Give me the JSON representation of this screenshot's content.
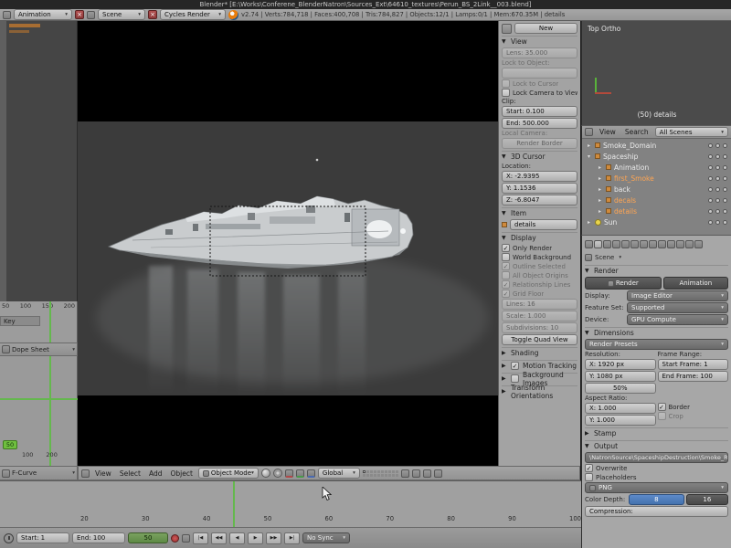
{
  "window": {
    "title": "Blender* [E:\\Works\\Conferene_BlenderNatron\\Sources_Ext\\64610_textures\\Perun_BS_2Link__003.blend]"
  },
  "infobar": {
    "layout_label": "Animation",
    "scene_label": "Scene",
    "engine_label": "Cycles Render",
    "stats": "v2.74 | Verts:784,718 | Faces:400,708 | Tris:784,827 | Objects:12/1 | Lamps:0/1 | Mem:670.35M | details"
  },
  "left": {
    "dope": {
      "ruler": [
        "50",
        "100",
        "150",
        "200"
      ],
      "channel": "Key",
      "header": "Dope Sheet"
    },
    "graph": {
      "frame": "50",
      "ruler": [
        "100",
        "200"
      ],
      "header": "F-Curve"
    }
  },
  "viewport": {
    "menus": [
      "View",
      "Select",
      "Add",
      "Object"
    ],
    "mode": "Object Mode",
    "orientation": "Global"
  },
  "npanel": {
    "new_button": "New",
    "view": {
      "title": "View",
      "lens": "Lens: 35.000",
      "lock_to_object": "Lock to Object:",
      "lock_to_cursor": "Lock to Cursor",
      "lock_camera": "Lock Camera to View",
      "clip": "Clip:",
      "clip_start": "Start: 0.100",
      "clip_end": "End: 500.000",
      "local_camera": "Local Camera:",
      "render_border": "Render Border"
    },
    "cursor3d": {
      "title": "3D Cursor",
      "location": "Location:",
      "x": "X: -2.9395",
      "y": "Y: 1.1536",
      "z": "Z: -6.8047"
    },
    "item": {
      "title": "Item",
      "name": "details"
    },
    "display": {
      "title": "Display",
      "items": [
        {
          "label": "Only Render",
          "checked": true
        },
        {
          "label": "World Background",
          "checked": false
        },
        {
          "label": "Outline Selected",
          "checked": true
        },
        {
          "label": "All Object Origins",
          "checked": false
        },
        {
          "label": "Relationship Lines",
          "checked": true
        },
        {
          "label": "Grid Floor",
          "checked": true
        }
      ],
      "lines": "Lines: 16",
      "scale": "Scale: 1.000",
      "subdivisions": "Subdivisions: 10",
      "toggle_quad": "Toggle Quad View"
    },
    "collapsed": [
      {
        "label": "Shading"
      },
      {
        "label": "Motion Tracking"
      },
      {
        "label": "Background Images"
      },
      {
        "label": "Transform Orientations"
      }
    ]
  },
  "miniview": {
    "label": "Top Ortho",
    "info": "(50) details"
  },
  "outliner": {
    "view": "View",
    "search": "Search",
    "scope": "All Scenes",
    "rows": [
      {
        "label": "Smoke_Domain"
      },
      {
        "label": "Spaceship"
      },
      {
        "label": "Animation"
      },
      {
        "label": "first_Smoke"
      },
      {
        "label": "back"
      },
      {
        "label": "decals"
      },
      {
        "label": "details"
      },
      {
        "label": "Sun"
      }
    ]
  },
  "properties": {
    "breadcrumb": "Scene",
    "render": {
      "title": "Render",
      "render_btn": "Render",
      "animation_btn": "Animation",
      "display_label": "Display:",
      "display_value": "Image Editor",
      "feature_label": "Feature Set:",
      "feature_value": "Supported",
      "device_label": "Device:",
      "device_value": "GPU Compute"
    },
    "dimensions": {
      "title": "Dimensions",
      "presets": "Render Presets",
      "resolution_label": "Resolution:",
      "res_x": "X: 1920 px",
      "res_y": "Y: 1080 px",
      "res_pct": "50%",
      "frame_range_label": "Frame Range:",
      "start": "Start Frame: 1",
      "end": "End Frame: 100",
      "aspect_label": "Aspect Ratio:",
      "aspect_x": "X: 1.000",
      "aspect_y": "Y: 1.000",
      "border": "Border",
      "crop": "Crop"
    },
    "stamp_title": "Stamp",
    "output": {
      "title": "Output",
      "path": "\\NatronSource\\SpaceshipDestruction\\Smoke_Re",
      "overwrite": "Overwrite",
      "placeholders": "Placeholders",
      "format": "PNG",
      "color_depth": "Color Depth:",
      "depth8": "8",
      "depth16": "16",
      "compression": "Compression:"
    }
  },
  "timeline": {
    "ruler": [
      "20",
      "30",
      "40",
      "50",
      "60",
      "70",
      "80",
      "90",
      "100"
    ],
    "start": "Start: 1",
    "end": "End: 100",
    "frame": "50",
    "sync": "No Sync"
  },
  "colors": {
    "accent_blue": "#4a79b5",
    "selected_orange": "#ffa552",
    "frame_green": "#64b84d"
  }
}
